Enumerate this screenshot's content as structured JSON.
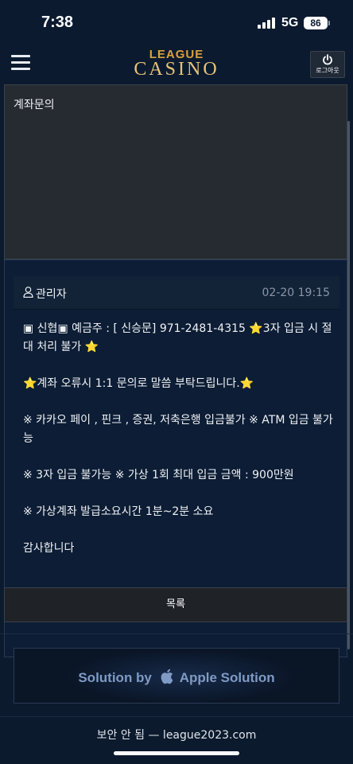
{
  "status_bar": {
    "time": "7:38",
    "network": "5G",
    "battery": "86"
  },
  "header": {
    "logo_top": "LEAGUE",
    "logo_main": "CASINO",
    "logout_label": "로그아웃",
    "menu_icon": "hamburger-menu-icon",
    "logout_icon": "power-icon"
  },
  "question": {
    "title": "계좌문의"
  },
  "answer": {
    "author": "관리자",
    "date": "02-20 19:15",
    "lines": [
      "▣ 신협▣ 예금주 : [ 신승문] 971-2481-4315 ⭐3자 입금 시 절대 처리 불가 ⭐",
      "⭐계좌 오류시 1:1 문의로 말씀 부탁드립니다.⭐",
      "※ 카카오 페이 , 핀크 , 증권, 저축은행 입금불가 ※ ATM 입금 불가능",
      "※ 3자 입금 불가능 ※ 가상 1회 최대 입금 금액 : 900만원",
      "※ 가상계좌 발급소요시간 1분~2분 소요",
      "감사합니다"
    ]
  },
  "list_button": "목록",
  "banner": {
    "prefix": "Solution by",
    "brand": "Apple Solution"
  },
  "footer": {
    "address": "보안 안 됨 — league2023.com"
  },
  "colors": {
    "background": "#0c1a2e",
    "logo_gold": "#e7c27a",
    "banner_text": "#7f9ac4"
  }
}
